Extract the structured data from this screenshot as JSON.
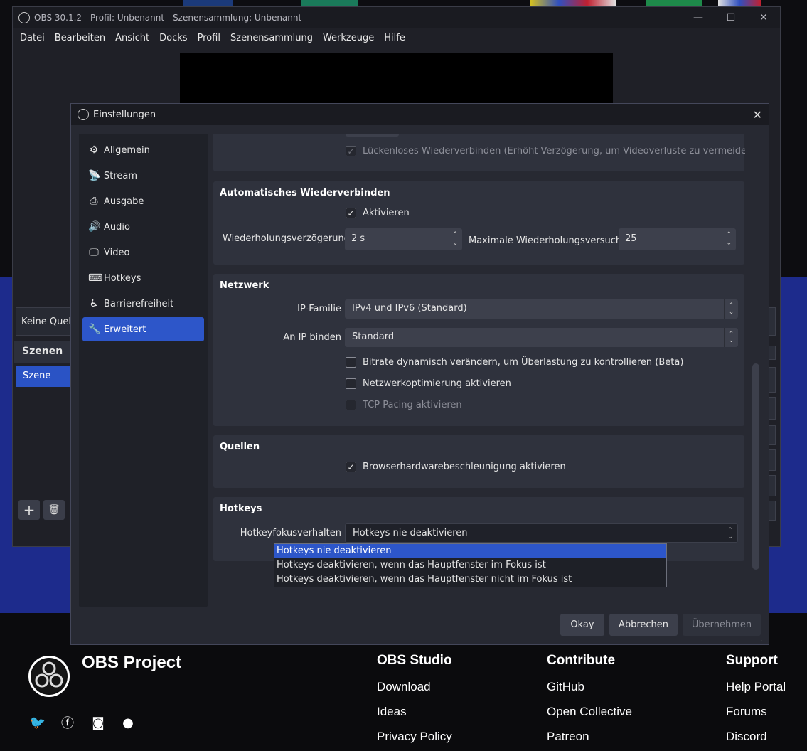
{
  "website": {
    "brand": "OBS Project",
    "social_icons": [
      "twitter-icon",
      "facebook-icon",
      "discord-icon",
      "github-icon"
    ],
    "columns": [
      {
        "title": "OBS Studio",
        "links": [
          "Download",
          "Ideas",
          "Privacy Policy"
        ]
      },
      {
        "title": "Contribute",
        "links": [
          "GitHub",
          "Open Collective",
          "Patreon"
        ]
      },
      {
        "title": "Support",
        "links": [
          "Help Portal",
          "Forums",
          "Discord"
        ]
      }
    ],
    "colors": {
      "mid_band": "#1d2b8c",
      "footer": "#0b0b0d"
    }
  },
  "obs_main": {
    "title": "OBS 30.1.2 - Profil: Unbenannt - Szenensammlung: Unbenannt",
    "menu": [
      "Datei",
      "Bearbeiten",
      "Ansicht",
      "Docks",
      "Profil",
      "Szenensammlung",
      "Werkzeuge",
      "Hilfe"
    ],
    "no_source_text": "Keine Quelle",
    "scenes_header": "Szenen",
    "scene_item": "Szene",
    "add_scene": "+",
    "remove_scene": "🗑"
  },
  "settings": {
    "title": "Einstellungen",
    "close": "✕",
    "sidebar": [
      {
        "label": "Allgemein",
        "icon": "gear-icon",
        "glyph": "⚙"
      },
      {
        "label": "Stream",
        "icon": "antenna-icon",
        "glyph": "📡"
      },
      {
        "label": "Ausgabe",
        "icon": "output-icon",
        "glyph": "⎙"
      },
      {
        "label": "Audio",
        "icon": "speaker-icon",
        "glyph": "🔊"
      },
      {
        "label": "Video",
        "icon": "monitor-icon",
        "glyph": "🖵"
      },
      {
        "label": "Hotkeys",
        "icon": "keyboard-icon",
        "glyph": "⌨"
      },
      {
        "label": "Barrierefreiheit",
        "icon": "accessibility-icon",
        "glyph": "♿"
      },
      {
        "label": "Erweitert",
        "icon": "wrench-icon",
        "glyph": "🔧",
        "active": true
      }
    ],
    "seamless_reconnect": "Lückenloses Wiederverbinden (Erhöht Verzögerung, um Videoverluste zu vermeiden)",
    "auto_reconnect": {
      "title": "Automatisches Wiederverbinden",
      "enable": "Aktivieren",
      "retry_delay_label": "Wiederholungsverzögerung",
      "retry_delay_value": "2 s",
      "max_retries_label": "Maximale Wiederholungsversuche",
      "max_retries_value": "25"
    },
    "network": {
      "title": "Netzwerk",
      "ip_family_label": "IP-Familie",
      "ip_family_value": "IPv4 und IPv6 (Standard)",
      "bind_ip_label": "An IP binden",
      "bind_ip_value": "Standard",
      "dynamic_bitrate": "Bitrate dynamisch verändern, um Überlastung zu kontrollieren (Beta)",
      "network_optim": "Netzwerkoptimierung aktivieren",
      "tcp_pacing": "TCP Pacing aktivieren"
    },
    "sources": {
      "title": "Quellen",
      "browser_hw_accel": "Browserhardwarebeschleunigung aktivieren"
    },
    "hotkeys": {
      "title": "Hotkeys",
      "focus_label": "Hotkeyfokusverhalten",
      "focus_value": "Hotkeys nie deaktivieren",
      "options": [
        "Hotkeys nie deaktivieren",
        "Hotkeys deaktivieren, wenn das Hauptfenster im Fokus ist",
        "Hotkeys deaktivieren, wenn das Hauptfenster nicht im Fokus ist"
      ]
    },
    "buttons": {
      "ok": "Okay",
      "cancel": "Abbrechen",
      "apply": "Übernehmen"
    },
    "accent_color": "#2d56c9"
  }
}
